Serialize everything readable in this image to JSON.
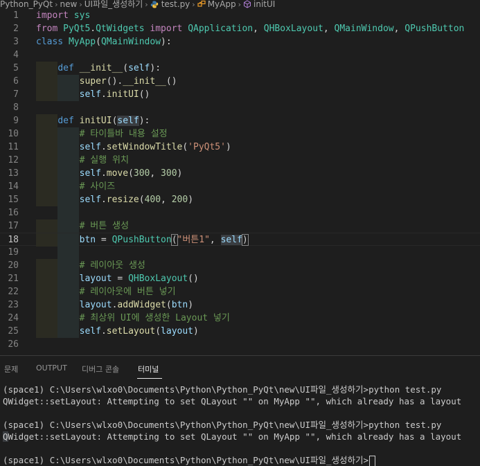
{
  "breadcrumb": {
    "items": [
      "Python_PyQt",
      "new",
      "UI파일_생성하기",
      "test.py",
      "MyApp",
      "initUI"
    ]
  },
  "editor": {
    "current_line": "18",
    "lines": [
      {
        "n": "1",
        "t": "import sys"
      },
      {
        "n": "2",
        "t": "from PyQt5.QtWidgets import QApplication, QHBoxLayout, QMainWindow, QPushButton"
      },
      {
        "n": "3",
        "t": "class MyApp(QMainWindow):"
      },
      {
        "n": "4",
        "t": ""
      },
      {
        "n": "5",
        "t": "    def __init__(self):"
      },
      {
        "n": "6",
        "t": "        super().__init__()"
      },
      {
        "n": "7",
        "t": "        self.initUI()"
      },
      {
        "n": "8",
        "t": ""
      },
      {
        "n": "9",
        "t": "    def initUI(self):"
      },
      {
        "n": "10",
        "t": "        # 타이틀바 내용 설정"
      },
      {
        "n": "11",
        "t": "        self.setWindowTitle('PyQt5')"
      },
      {
        "n": "12",
        "t": "        # 실행 위치"
      },
      {
        "n": "13",
        "t": "        self.move(300, 300)"
      },
      {
        "n": "14",
        "t": "        # 사이즈"
      },
      {
        "n": "15",
        "t": "        self.resize(400, 200)"
      },
      {
        "n": "16",
        "t": ""
      },
      {
        "n": "17",
        "t": "        # 버튼 생성"
      },
      {
        "n": "18",
        "t": "        btn = QPushButton(\"버튼1\", self)"
      },
      {
        "n": "19",
        "t": ""
      },
      {
        "n": "20",
        "t": "        # 레이아웃 생성"
      },
      {
        "n": "21",
        "t": "        layout = QHBoxLayout()"
      },
      {
        "n": "22",
        "t": "        # 레이아웃에 버튼 넣기"
      },
      {
        "n": "23",
        "t": "        layout.addWidget(btn)"
      },
      {
        "n": "24",
        "t": "        # 최상위 UI에 생성한 Layout 넣기"
      },
      {
        "n": "25",
        "t": "        self.setLayout(layout)"
      },
      {
        "n": "26",
        "t": ""
      }
    ]
  },
  "panel": {
    "tabs": [
      {
        "label": "문제",
        "active": false
      },
      {
        "label": "OUTPUT",
        "active": false
      },
      {
        "label": "디버그 콘솔",
        "active": false
      },
      {
        "label": "터미널",
        "active": true
      }
    ],
    "terminal": {
      "lines": [
        "(space1) C:\\Users\\wlxo0\\Documents\\Python\\Python_PyQt\\new\\UI파일_생성하기>python test.py",
        "QWidget::setLayout: Attempting to set QLayout \"\" on MyApp \"\", which already has a layout",
        "",
        "(space1) C:\\Users\\wlxo0\\Documents\\Python\\Python_PyQt\\new\\UI파일_생성하기>python test.py",
        "QWidget::setLayout: Attempting to set QLayout \"\" on MyApp \"\", which already has a layout",
        "",
        "(space1) C:\\Users\\wlxo0\\Documents\\Python\\Python_PyQt\\new\\UI파일_생성하기>"
      ]
    }
  },
  "colors": {
    "background": "#1e1e1e",
    "keyword": "#569cd6",
    "class": "#4ec9b0",
    "function": "#dcdcaa",
    "variable": "#9cdcfe",
    "string": "#ce9178",
    "number": "#b5cea8",
    "comment": "#6a9955"
  }
}
